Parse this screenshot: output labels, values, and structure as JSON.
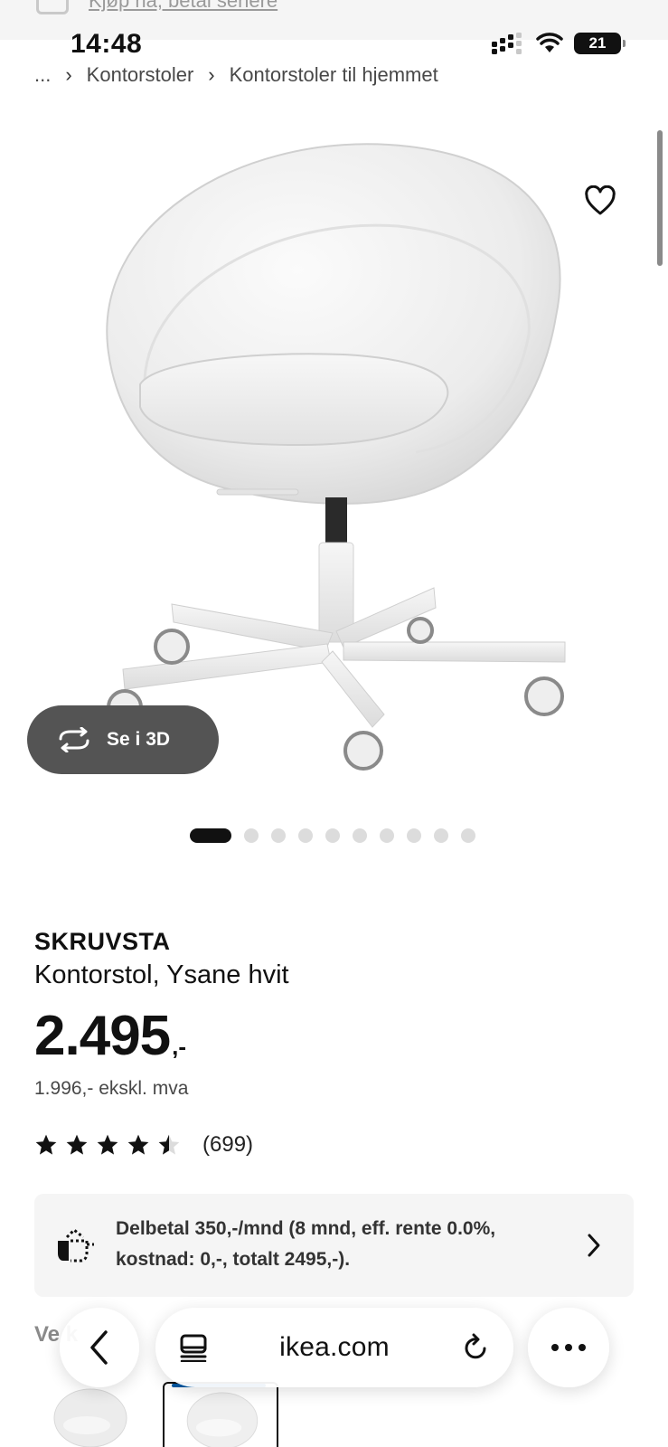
{
  "status_bar": {
    "time": "14:48",
    "battery": "21",
    "signal_icon": "cellular-signal-icon",
    "wifi_icon": "wifi-icon"
  },
  "top_banner": {
    "text": "Kjøp nå, betal senere"
  },
  "breadcrumb": {
    "items": [
      "...",
      "Kontorstoler",
      "Kontorstoler til hjemmet"
    ]
  },
  "product": {
    "name": "SKRUVSTA",
    "description": "Kontorstol, Ysane hvit",
    "price": "2.495",
    "price_suffix": ",-",
    "price_ex_vat": "1.996,- ekskl. mva",
    "rating": 4.5,
    "rating_max": 5,
    "rating_count": "(699)"
  },
  "gallery": {
    "view_3d_label": "Se i 3D",
    "image_count": 10,
    "active_index": 0
  },
  "financing": {
    "text": "Delbetal 350,-/mnd (8 mnd, eff. rente 0.0%, kostnad: 0,-, totalt 2495,-)."
  },
  "below": {
    "label": "Ve         k"
  },
  "browser": {
    "url": "ikea.com"
  },
  "colors": {
    "text": "#111111",
    "muted": "#484848",
    "pill_dark": "#545454",
    "panel_bg": "#f5f5f5",
    "ikea_blue": "#0058a3"
  }
}
